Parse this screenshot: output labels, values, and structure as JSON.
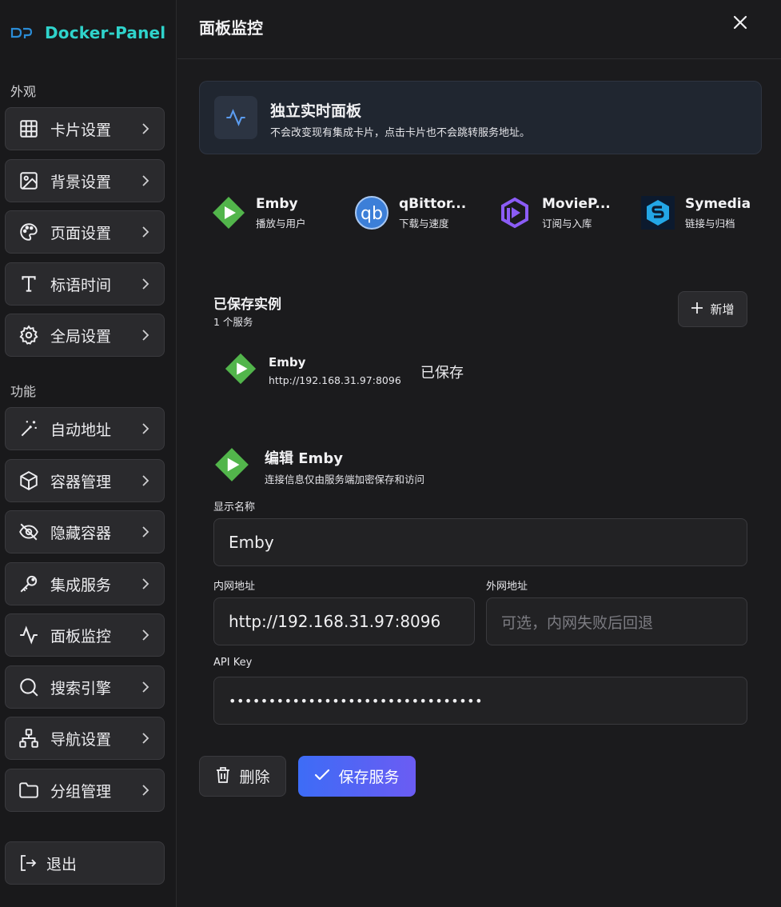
{
  "brand": {
    "name": "Docker-Panel",
    "logo_icon": "dp-logo-icon"
  },
  "sidebar": {
    "section_appearance": "外观",
    "section_features": "功能",
    "items": [
      {
        "label": "卡片设置",
        "icon": "grid-icon"
      },
      {
        "label": "背景设置",
        "icon": "image-icon"
      },
      {
        "label": "页面设置",
        "icon": "palette-icon"
      },
      {
        "label": "标语时间",
        "icon": "type-icon"
      },
      {
        "label": "全局设置",
        "icon": "gear-icon"
      },
      {
        "label": "自动地址",
        "icon": "magic-wand-icon"
      },
      {
        "label": "容器管理",
        "icon": "box-icon"
      },
      {
        "label": "隐藏容器",
        "icon": "eye-off-icon"
      },
      {
        "label": "集成服务",
        "icon": "key-icon"
      },
      {
        "label": "面板监控",
        "icon": "activity-icon"
      },
      {
        "label": "搜索引擎",
        "icon": "search-icon"
      },
      {
        "label": "导航设置",
        "icon": "sitemap-icon"
      },
      {
        "label": "分组管理",
        "icon": "folder-icon"
      }
    ],
    "logout_label": "退出"
  },
  "header": {
    "title": "面板监控"
  },
  "info": {
    "title": "独立实时面板",
    "desc": "不会改变现有集成卡片，点击卡片也不会跳转服务地址。"
  },
  "services": [
    {
      "name": "Emby",
      "sub": "播放与用户",
      "color": "#52b54b"
    },
    {
      "name": "qBittor...",
      "sub": "下载与速度",
      "color": "#3c7fd8"
    },
    {
      "name": "MovieP...",
      "sub": "订阅与入库",
      "color": "#8b5cf6"
    },
    {
      "name": "Symedia",
      "sub": "链接与归档",
      "color": "#23a6e6"
    }
  ],
  "saved": {
    "title": "已保存实例",
    "count": "1 个服务",
    "add_label": "新增",
    "items": [
      {
        "name": "Emby",
        "url": "http://192.168.31.97:8096",
        "state": "已保存"
      }
    ]
  },
  "edit": {
    "title": "编辑 Emby",
    "subtitle": "连接信息仅由服务端加密保存和访问",
    "display_name_label": "显示名称",
    "display_name_value": "Emby",
    "lan_label": "内网地址",
    "lan_value": "http://192.168.31.97:8096",
    "wan_label": "外网地址",
    "wan_placeholder": "可选，内网失败后回退",
    "api_key_label": "API Key",
    "api_key_value": "••••••••••••••••••••••••••••••••"
  },
  "actions": {
    "delete_label": "删除",
    "save_label": "保存服务"
  },
  "colors": {
    "accent": "#2fd3cb",
    "emby_green": "#52b54b",
    "save_gradient_start": "#3d6cf6",
    "save_gradient_end": "#6b5cf3"
  }
}
